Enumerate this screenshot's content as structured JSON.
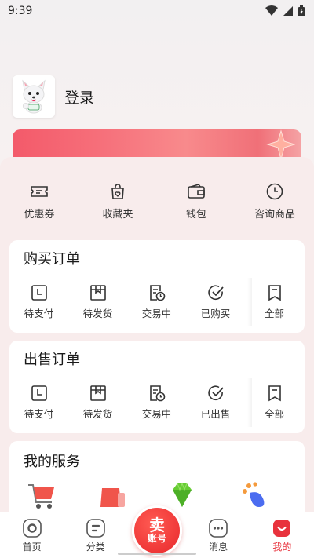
{
  "status": {
    "time": "9:39"
  },
  "profile": {
    "login_label": "登录"
  },
  "quick_links": [
    {
      "label": "优惠券",
      "icon": "coupon-icon"
    },
    {
      "label": "收藏夹",
      "icon": "favorites-bag-icon"
    },
    {
      "label": "钱包",
      "icon": "wallet-icon"
    },
    {
      "label": "咨询商品",
      "icon": "clock-icon"
    }
  ],
  "buy_orders": {
    "title": "购买订单",
    "items": [
      {
        "label": "待支付",
        "icon": "pending-pay-icon"
      },
      {
        "label": "待发货",
        "icon": "pending-ship-icon"
      },
      {
        "label": "交易中",
        "icon": "in-trade-icon"
      },
      {
        "label": "已购买",
        "icon": "check-icon"
      },
      {
        "label": "全部",
        "icon": "all-orders-icon"
      }
    ]
  },
  "sell_orders": {
    "title": "出售订单",
    "items": [
      {
        "label": "待支付",
        "icon": "pending-pay-icon"
      },
      {
        "label": "待发货",
        "icon": "pending-ship-icon"
      },
      {
        "label": "交易中",
        "icon": "in-trade-icon"
      },
      {
        "label": "已出售",
        "icon": "check-icon"
      },
      {
        "label": "全部",
        "icon": "all-orders-icon"
      }
    ]
  },
  "services": {
    "title": "我的服务"
  },
  "tabbar": {
    "items": [
      {
        "label": "首页",
        "icon": "home-icon"
      },
      {
        "label": "分类",
        "icon": "category-icon"
      },
      {
        "label": "消息",
        "icon": "message-icon"
      },
      {
        "label": "我的",
        "icon": "mine-icon"
      }
    ],
    "sell_big": "卖",
    "sell_small": "账号"
  },
  "colors": {
    "accent": "#e8323c",
    "banner": "#f35a6a"
  }
}
